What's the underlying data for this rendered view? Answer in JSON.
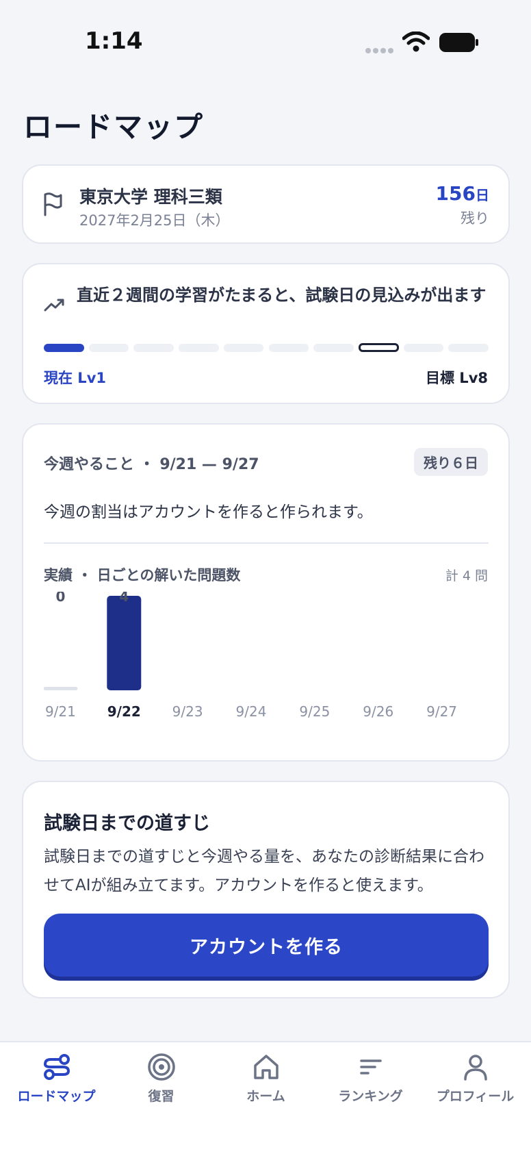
{
  "status": {
    "time": "1:14"
  },
  "page": {
    "title": "ロードマップ"
  },
  "goal": {
    "name": "東京大学 理科三類",
    "date": "2027年2月25日（木）",
    "days_num": "156",
    "days_unit": "日",
    "days_label": "残り"
  },
  "progress": {
    "message": "直近２週間の学習がたまると、試験日の見込みが出ます",
    "current_label": "現在 Lv1",
    "target_label": "目標 Lv8",
    "current_level": 1,
    "target_level": 8,
    "total_levels": 10
  },
  "week": {
    "header": "今週やること ・ 9/21 — 9/27",
    "remain_badge": "残り６日",
    "message": "今週の割当はアカウントを作ると作られます。"
  },
  "results": {
    "header": "実績 ・ 日ごとの解いた問題数",
    "total": "計 4 問"
  },
  "chart_data": {
    "type": "bar",
    "categories": [
      "9/21",
      "9/22",
      "9/23",
      "9/24",
      "9/25",
      "9/26",
      "9/27"
    ],
    "values": [
      0,
      4,
      null,
      null,
      null,
      null,
      null
    ],
    "highlight": "9/22",
    "ylim": [
      0,
      4
    ]
  },
  "roadmap": {
    "title": "試験日までの道すじ",
    "description": "試験日までの道すじと今週やる量を、あなたの診断結果に合わせてAIが組み立てます。アカウントを作ると使えます。",
    "button_label": "アカウントを作る"
  },
  "tabs": [
    {
      "label": "ロードマップ",
      "icon": "route-icon",
      "active": true
    },
    {
      "label": "復習",
      "icon": "target-icon",
      "active": false
    },
    {
      "label": "ホーム",
      "icon": "home-icon",
      "active": false
    },
    {
      "label": "ランキング",
      "icon": "ranking-icon",
      "active": false
    },
    {
      "label": "プロフィール",
      "icon": "profile-icon",
      "active": false
    }
  ],
  "colors": {
    "accent": "#2a45c4",
    "bar": "#1e2f8a",
    "background": "#f4f5f8"
  }
}
